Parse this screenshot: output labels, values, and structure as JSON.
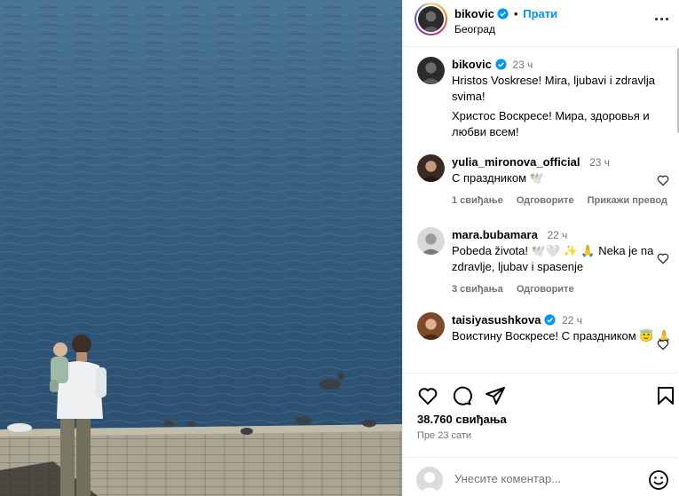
{
  "post": {
    "author": "bikovic",
    "follow_label": "Прати",
    "location": "Београд",
    "caption_time": "23 ч",
    "caption_lines": [
      "Hristos Voskrese! Mira, ljubavi i zdravlja svima!",
      "Христос Воскресе! Мира, здоровья и любви всем!"
    ],
    "likes": "38.760 свиђања",
    "posted_ago": "Пре 23 сати"
  },
  "comments": [
    {
      "user": "yulia_mironova_official",
      "time": "23 ч",
      "text": "С праздником 🕊️",
      "likes": "1 свиђање",
      "reply": "Одговорите",
      "extra": "Прикажи превод"
    },
    {
      "user": "mara.bubamara",
      "time": "22 ч",
      "text": "Pobeda života! 🕊️🤍 ✨ 🙏  Neka je na zdravlje, ljubav i spasenje",
      "likes": "3 свиђања",
      "reply": "Одговорите"
    },
    {
      "user": "taisiyasushkova",
      "time": "22 ч",
      "text": "Воистину Воскресе! С праздником 😇 🙏"
    }
  ],
  "comment_input": {
    "placeholder": "Унесите коментар..."
  },
  "icons": {
    "like": "heart-icon",
    "comment": "comment-icon",
    "share": "paper-plane-icon",
    "save": "bookmark-icon",
    "more": "more-horizontal-icon",
    "emoji": "emoji-icon",
    "verified": "verified-badge-icon"
  },
  "colors": {
    "link": "#0095f6",
    "muted": "#737373",
    "verified": "#0095f6",
    "water": "#375f80"
  }
}
